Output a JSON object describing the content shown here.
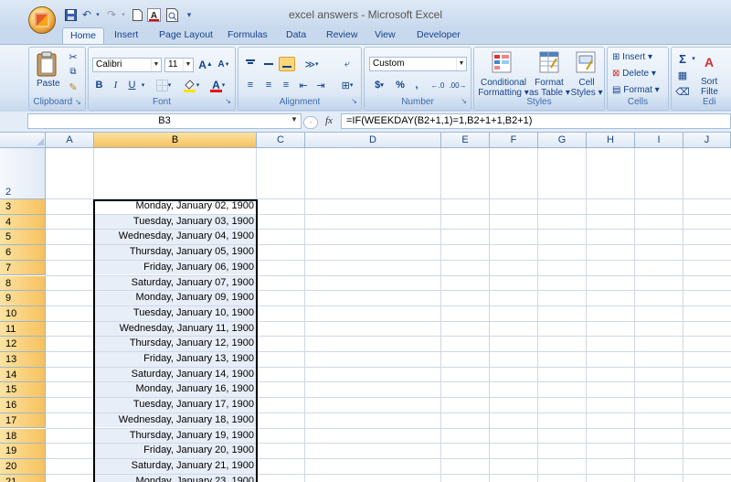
{
  "window": {
    "title": "excel answers - Microsoft Excel"
  },
  "quick_access": {
    "save_icon": "save-icon",
    "undo_icon": "undo-icon",
    "redo_icon": "redo-icon",
    "sep": "▾"
  },
  "tabs": [
    {
      "label": "Home",
      "active": true
    },
    {
      "label": "Insert"
    },
    {
      "label": "Page Layout"
    },
    {
      "label": "Formulas"
    },
    {
      "label": "Data"
    },
    {
      "label": "Review"
    },
    {
      "label": "View"
    },
    {
      "label": "Developer"
    }
  ],
  "ribbon": {
    "clipboard": {
      "label": "Clipboard",
      "paste": "Paste"
    },
    "font": {
      "label": "Font",
      "name": "Calibri",
      "size": "11",
      "bold": "B",
      "italic": "I",
      "underline": "U",
      "grow": "A",
      "shrink": "A"
    },
    "alignment": {
      "label": "Alignment"
    },
    "number": {
      "label": "Number",
      "format": "Custom",
      "currency": "$",
      "percent": "%",
      "comma": ","
    },
    "styles": {
      "label": "Styles",
      "conditional": [
        "Conditional",
        "Formatting ▾"
      ],
      "format_table": [
        "Format",
        "as Table ▾"
      ],
      "cell_styles": [
        "Cell",
        "Styles ▾"
      ]
    },
    "cells": {
      "label": "Cells",
      "insert": "Insert ▾",
      "delete": "Delete ▾",
      "format": "Format ▾"
    },
    "editing": {
      "label": "Edi",
      "sort": [
        "Sort",
        "Filte"
      ]
    }
  },
  "formula_bar": {
    "name_box": "B3",
    "fx": "fx",
    "formula": "=IF(WEEKDAY(B2+1,1)=1,B2+1+1,B2+1)"
  },
  "columns": [
    "A",
    "B",
    "C",
    "D",
    "E",
    "F",
    "G",
    "H",
    "I",
    "J"
  ],
  "rows": [
    {
      "num": "2",
      "b": ""
    },
    {
      "num": "3",
      "b": "Monday, January 02, 1900"
    },
    {
      "num": "4",
      "b": "Tuesday, January 03, 1900"
    },
    {
      "num": "5",
      "b": "Wednesday, January 04, 1900"
    },
    {
      "num": "6",
      "b": "Thursday, January 05, 1900"
    },
    {
      "num": "7",
      "b": "Friday, January 06, 1900"
    },
    {
      "num": "8",
      "b": "Saturday, January 07, 1900"
    },
    {
      "num": "9",
      "b": "Monday, January 09, 1900"
    },
    {
      "num": "10",
      "b": "Tuesday, January 10, 1900"
    },
    {
      "num": "11",
      "b": "Wednesday, January 11, 1900"
    },
    {
      "num": "12",
      "b": "Thursday, January 12, 1900"
    },
    {
      "num": "13",
      "b": "Friday, January 13, 1900"
    },
    {
      "num": "14",
      "b": "Saturday, January 14, 1900"
    },
    {
      "num": "15",
      "b": "Monday, January 16, 1900"
    },
    {
      "num": "16",
      "b": "Tuesday, January 17, 1900"
    },
    {
      "num": "17",
      "b": "Wednesday, January 18, 1900"
    },
    {
      "num": "18",
      "b": "Thursday, January 19, 1900"
    },
    {
      "num": "19",
      "b": "Friday, January 20, 1900"
    },
    {
      "num": "20",
      "b": "Saturday, January 21, 1900"
    },
    {
      "num": "21",
      "b": "Monday, January 23, 1900"
    }
  ],
  "colors": {
    "accent": "#15428b",
    "selection_header": "#f7c15e"
  }
}
